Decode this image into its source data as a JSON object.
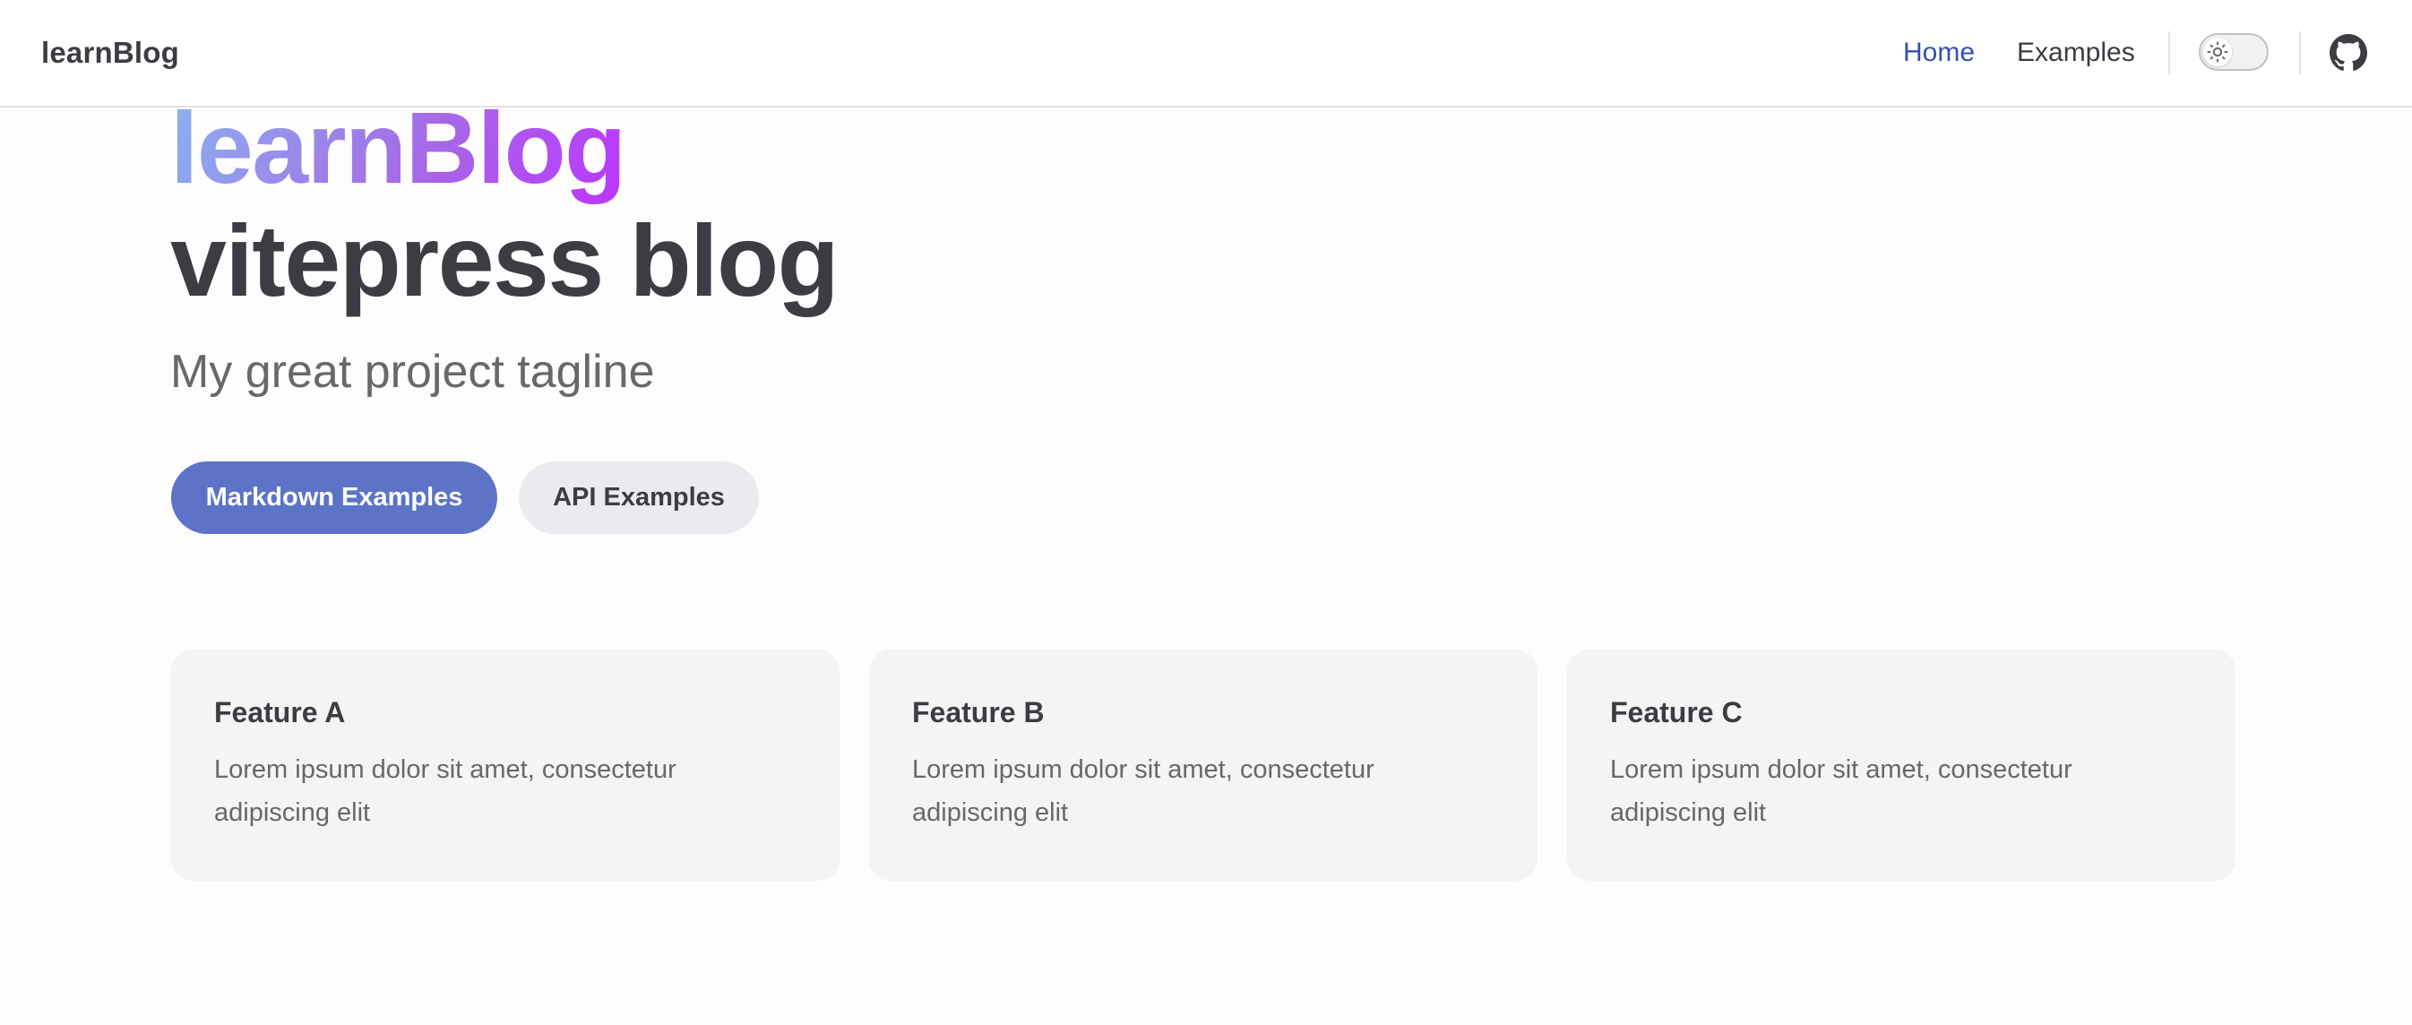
{
  "nav": {
    "site_title": "learnBlog",
    "links": [
      {
        "label": "Home",
        "active": true
      },
      {
        "label": "Examples",
        "active": false
      }
    ],
    "theme_toggle_icon": "sun-icon",
    "social_icon": "github-icon"
  },
  "hero": {
    "name": "learnBlog",
    "text": "vitepress blog",
    "tagline": "My great project tagline",
    "actions": [
      {
        "label": "Markdown Examples",
        "theme": "brand"
      },
      {
        "label": "API Examples",
        "theme": "alt"
      }
    ]
  },
  "features": [
    {
      "title": "Feature A",
      "details": "Lorem ipsum dolor sit amet, consectetur adipiscing elit"
    },
    {
      "title": "Feature B",
      "details": "Lorem ipsum dolor sit amet, consectetur adipiscing elit"
    },
    {
      "title": "Feature C",
      "details": "Lorem ipsum dolor sit amet, consectetur adipiscing elit"
    }
  ],
  "colors": {
    "brand": "#5c73c7",
    "nav_active": "#3451b2",
    "text": "#3c3c43",
    "text_muted": "#67676c",
    "gradient_start": "#8ab4f0",
    "gradient_end": "#bd34fe"
  }
}
